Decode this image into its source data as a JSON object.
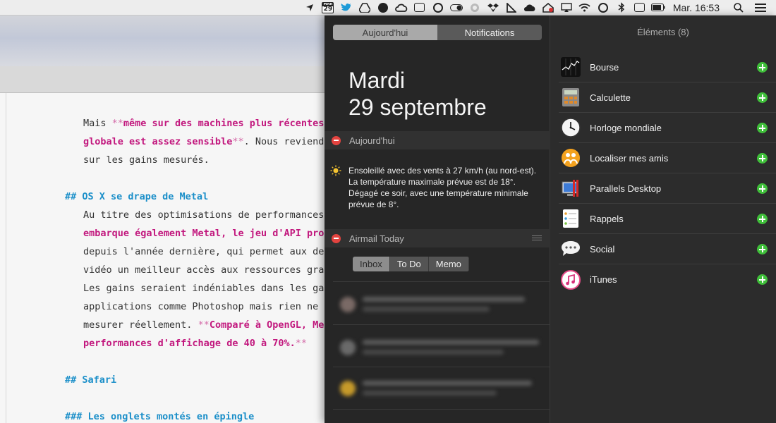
{
  "menubar": {
    "icons": [
      "location-arrow-icon",
      "calendar-icon",
      "twitter-icon",
      "google-drive-icon",
      "evernote-icon",
      "creative-cloud-icon",
      "screen-icon",
      "info-icon",
      "toggle-icon",
      "spiral-icon",
      "dropbox-icon",
      "triangle-ruler-icon",
      "cloud-check-icon",
      "backup-house-icon",
      "airplay-icon",
      "wifi-icon",
      "time-machine-icon",
      "bluetooth-icon",
      "date-icon",
      "battery-icon"
    ],
    "calendar_month": "MAR",
    "calendar_day": "29",
    "clock": "Mar. 16:53"
  },
  "editor": {
    "lines": [
      {
        "parts": [
          {
            "t": "Mais ",
            "s": ""
          },
          {
            "t": "**",
            "s": "pink-mark"
          },
          {
            "t": "même sur des machines plus récentes",
            "s": "bold-pink"
          }
        ]
      },
      {
        "parts": [
          {
            "t": "globale est assez sensible",
            "s": "bold-pink"
          },
          {
            "t": "**",
            "s": "pink-mark"
          },
          {
            "t": ". Nous reviend",
            "s": ""
          }
        ]
      },
      {
        "parts": [
          {
            "t": "sur les gains mesurés.",
            "s": ""
          }
        ]
      },
      {
        "parts": []
      },
      {
        "heading": true,
        "parts": [
          {
            "t": "## OS X se drape de Metal",
            "s": "head-blue"
          }
        ]
      },
      {
        "parts": [
          {
            "t": "Au titre des optimisations de performances",
            "s": ""
          }
        ]
      },
      {
        "parts": [
          {
            "t": "embarque également Metal, le jeu d'API pro",
            "s": "bold-pink"
          }
        ]
      },
      {
        "parts": [
          {
            "t": "depuis l'année dernière, qui permet aux de",
            "s": ""
          }
        ]
      },
      {
        "parts": [
          {
            "t": "vidéo un meilleur accès aux ressources gra",
            "s": ""
          }
        ]
      },
      {
        "parts": [
          {
            "t": "Les gains seraient indéniables dans les ga",
            "s": ""
          }
        ]
      },
      {
        "parts": [
          {
            "t": "applications comme Photoshop mais rien ne",
            "s": ""
          }
        ]
      },
      {
        "parts": [
          {
            "t": "mesurer réellement. ",
            "s": ""
          },
          {
            "t": "**",
            "s": "pink-mark"
          },
          {
            "t": "Comparé à OpenGL, Me",
            "s": "bold-pink"
          }
        ]
      },
      {
        "parts": [
          {
            "t": "performances d'affichage de 40 à 70%.",
            "s": "bold-pink"
          },
          {
            "t": "**",
            "s": "pink-mark"
          }
        ]
      },
      {
        "parts": []
      },
      {
        "heading": true,
        "parts": [
          {
            "t": "## Safari",
            "s": "head-blue"
          }
        ]
      },
      {
        "parts": []
      },
      {
        "heading": true,
        "parts": [
          {
            "t": "### Les onglets montés en épingle",
            "s": "head-blue"
          }
        ]
      }
    ]
  },
  "notification_center": {
    "tabs": {
      "today": "Aujourd'hui",
      "notifications": "Notifications"
    },
    "date_day": "Mardi",
    "date_full": "29 septembre",
    "today_widget": {
      "title": "Aujourd'hui",
      "weather_text": "Ensoleillé avec des vents à 27 km/h (au nord-est). La température maximale prévue est de 18°. Dégagé ce soir, avec une température minimale prévue de 8°."
    },
    "airmail_widget": {
      "title": "Airmail Today",
      "tabs": [
        "Inbox",
        "To Do",
        "Memo"
      ]
    },
    "elements": {
      "title": "Éléments (8)",
      "items": [
        {
          "label": "Bourse",
          "icon": "stocks-icon"
        },
        {
          "label": "Calculette",
          "icon": "calculator-icon"
        },
        {
          "label": "Horloge mondiale",
          "icon": "world-clock-icon"
        },
        {
          "label": "Localiser mes amis",
          "icon": "find-friends-icon"
        },
        {
          "label": "Parallels Desktop",
          "icon": "parallels-icon"
        },
        {
          "label": "Rappels",
          "icon": "reminders-icon"
        },
        {
          "label": "Social",
          "icon": "social-icon"
        },
        {
          "label": "iTunes",
          "icon": "itunes-icon"
        }
      ]
    }
  },
  "colors": {
    "accent_pink": "#c2187e",
    "heading_blue": "#1b8fc9",
    "remove_red": "#e3433f",
    "add_green": "#3fbf3a"
  }
}
